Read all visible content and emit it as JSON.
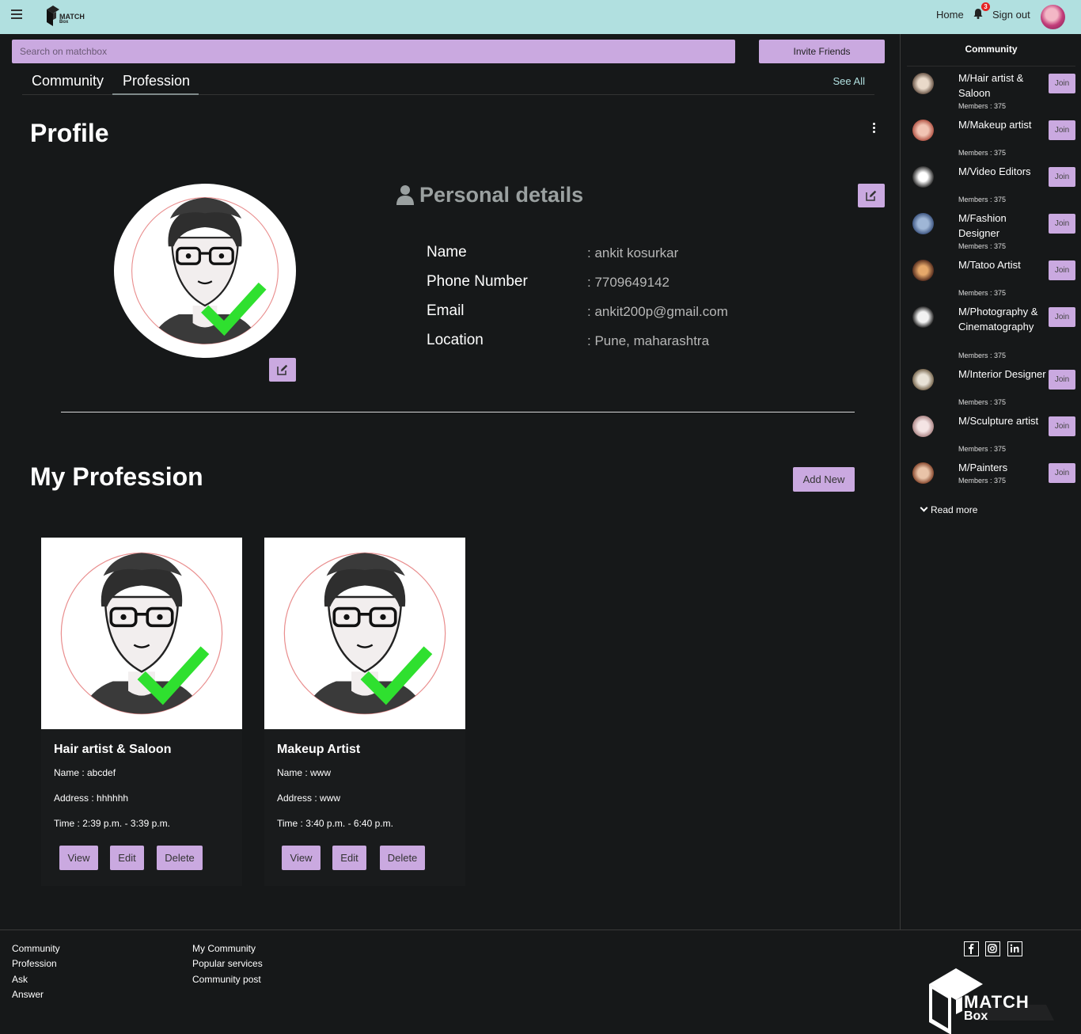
{
  "header": {
    "logo_top": "MATCH",
    "logo_bottom": "Box",
    "nav_home": "Home",
    "notification_count": "3",
    "nav_signout": "Sign out"
  },
  "search": {
    "placeholder": "Search on matchbox"
  },
  "invite_label": "Invite Friends",
  "tabs": [
    {
      "label": "Community"
    },
    {
      "label": "Profession"
    }
  ],
  "see_all": "See All",
  "profile": {
    "title": "Profile",
    "section_title": "Personal details",
    "fields": [
      {
        "label": "Name",
        "value": ": ankit kosurkar"
      },
      {
        "label": "Phone Number",
        "value": ": 7709649142"
      },
      {
        "label": "Email",
        "value": ": ankit200p@gmail.com"
      },
      {
        "label": "Location",
        "value": ": Pune, maharashtra"
      }
    ]
  },
  "profession": {
    "title": "My Profession",
    "add_new": "Add New",
    "cards": [
      {
        "title": "Hair artist & Saloon",
        "name": "Name : abcdef",
        "address": "Address : hhhhhh",
        "time": "Time : 2:39 p.m. - 3:39 p.m.",
        "view": "View",
        "edit": "Edit",
        "delete": "Delete"
      },
      {
        "title": "Makeup Artist",
        "name": "Name : www",
        "address": "Address : www",
        "time": "Time : 3:40 p.m. - 6:40 p.m.",
        "view": "View",
        "edit": "Edit",
        "delete": "Delete"
      }
    ]
  },
  "sidebar": {
    "title": "Community",
    "join_label": "Join",
    "read_more": "Read more",
    "items": [
      {
        "name": "M/Hair artist & Saloon",
        "members": "Members : 375"
      },
      {
        "name": "M/Makeup artist",
        "members": "Members : 375"
      },
      {
        "name": "M/Video Editors",
        "members": "Members : 375"
      },
      {
        "name": "M/Fashion Designer",
        "members": "Members : 375"
      },
      {
        "name": "M/Tatoo Artist",
        "members": "Members : 375"
      },
      {
        "name": "M/Photography & Cinematography",
        "members": "Members : 375"
      },
      {
        "name": "M/Interior Designer",
        "members": "Members : 375"
      },
      {
        "name": "M/Sculpture artist",
        "members": "Members : 375"
      },
      {
        "name": "M/Painters",
        "members": "Members : 375"
      }
    ]
  },
  "footer": {
    "col1": [
      "Community",
      "Profession",
      "Ask",
      "Answer"
    ],
    "col2": [
      "My Community",
      "Popular services",
      "Community post"
    ],
    "social": [
      "facebook-icon",
      "instagram-icon",
      "linkedin-icon"
    ],
    "logo_top": "MATCH",
    "logo_bottom": "Box"
  },
  "colors": {
    "topbar": "#b1e0e0",
    "accent": "#caa9e0",
    "background": "#161819",
    "checkmark": "#2fe02f"
  }
}
